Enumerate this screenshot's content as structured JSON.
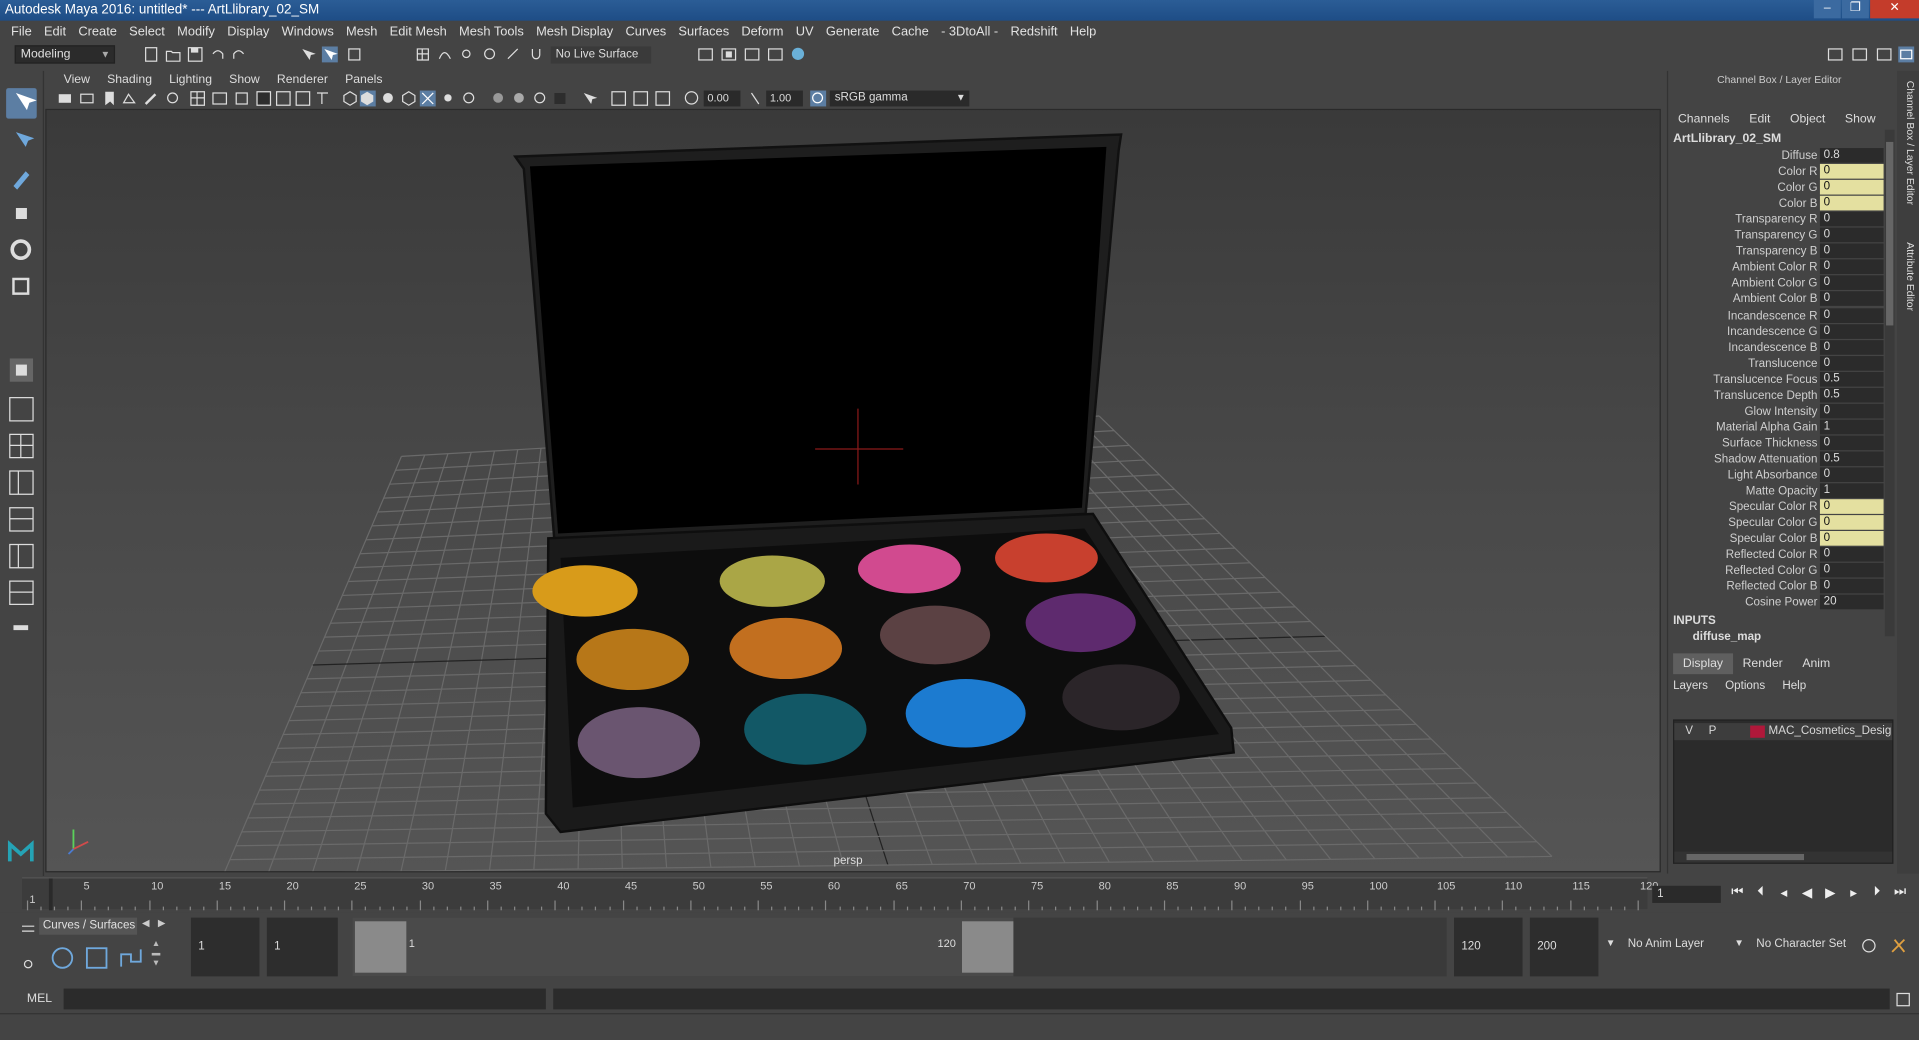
{
  "window": {
    "title": "Autodesk Maya 2016: untitled*   ---   ArtLlibrary_02_SM",
    "minimize": "–",
    "maximize": "❐",
    "close": "✕"
  },
  "menubar": [
    "File",
    "Edit",
    "Create",
    "Select",
    "Modify",
    "Display",
    "Windows",
    "Mesh",
    "Edit Mesh",
    "Mesh Tools",
    "Mesh Display",
    "Curves",
    "Surfaces",
    "Deform",
    "UV",
    "Generate",
    "Cache",
    "- 3DtoAll -",
    "Redshift",
    "Help"
  ],
  "status_line": {
    "mode": "Modeling",
    "live_surface": "No Live Surface"
  },
  "viewport": {
    "menu": [
      "View",
      "Shading",
      "Lighting",
      "Show",
      "Renderer",
      "Panels"
    ],
    "exposure": "0.00",
    "gamma": "1.00",
    "colorspace": "sRGB gamma",
    "camera_label": "persp"
  },
  "channel_box": {
    "header": "Channel Box / Layer Editor",
    "menu": [
      "Channels",
      "Edit",
      "Object",
      "Show"
    ],
    "object_name": "ArtLlibrary_02_SM",
    "attributes": [
      {
        "label": "Diffuse",
        "value": "0.8",
        "keyed": false
      },
      {
        "label": "Color R",
        "value": "0",
        "keyed": true
      },
      {
        "label": "Color G",
        "value": "0",
        "keyed": true
      },
      {
        "label": "Color B",
        "value": "0",
        "keyed": true
      },
      {
        "label": "Transparency R",
        "value": "0",
        "keyed": false
      },
      {
        "label": "Transparency G",
        "value": "0",
        "keyed": false
      },
      {
        "label": "Transparency B",
        "value": "0",
        "keyed": false
      },
      {
        "label": "Ambient Color R",
        "value": "0",
        "keyed": false
      },
      {
        "label": "Ambient Color G",
        "value": "0",
        "keyed": false
      },
      {
        "label": "Ambient Color B",
        "value": "0",
        "keyed": false
      },
      {
        "label": "Incandescence R",
        "value": "0",
        "keyed": false
      },
      {
        "label": "Incandescence G",
        "value": "0",
        "keyed": false
      },
      {
        "label": "Incandescence B",
        "value": "0",
        "keyed": false
      },
      {
        "label": "Translucence",
        "value": "0",
        "keyed": false
      },
      {
        "label": "Translucence Focus",
        "value": "0.5",
        "keyed": false
      },
      {
        "label": "Translucence Depth",
        "value": "0.5",
        "keyed": false
      },
      {
        "label": "Glow Intensity",
        "value": "0",
        "keyed": false
      },
      {
        "label": "Material Alpha Gain",
        "value": "1",
        "keyed": false
      },
      {
        "label": "Surface Thickness",
        "value": "0",
        "keyed": false
      },
      {
        "label": "Shadow Attenuation",
        "value": "0.5",
        "keyed": false
      },
      {
        "label": "Light Absorbance",
        "value": "0",
        "keyed": false
      },
      {
        "label": "Matte Opacity",
        "value": "1",
        "keyed": false
      },
      {
        "label": "Specular Color R",
        "value": "0",
        "keyed": true
      },
      {
        "label": "Specular Color G",
        "value": "0",
        "keyed": true
      },
      {
        "label": "Specular Color B",
        "value": "0",
        "keyed": true
      },
      {
        "label": "Reflected Color R",
        "value": "0",
        "keyed": false
      },
      {
        "label": "Reflected Color G",
        "value": "0",
        "keyed": false
      },
      {
        "label": "Reflected Color B",
        "value": "0",
        "keyed": false
      },
      {
        "label": "Cosine Power",
        "value": "20",
        "keyed": false
      }
    ],
    "inputs_header": "INPUTS",
    "inputs_value": "diffuse_map"
  },
  "layer_editor": {
    "tabs": [
      "Display",
      "Render",
      "Anim"
    ],
    "active_tab": "Display",
    "menu": [
      "Layers",
      "Options",
      "Help"
    ],
    "layer": {
      "v": "V",
      "p": "P",
      "name": "MAC_Cosmetics_Designer",
      "color": "#b0183a"
    }
  },
  "side_tabs": [
    "Channel Box / Layer Editor",
    "Attribute Editor"
  ],
  "time_slider": {
    "ticks": [
      "1",
      "5",
      "10",
      "15",
      "20",
      "25",
      "30",
      "35",
      "40",
      "45",
      "50",
      "55",
      "60",
      "65",
      "70",
      "75",
      "80",
      "85",
      "90",
      "95",
      "100",
      "105",
      "110",
      "115",
      "120"
    ],
    "current_frame": "1"
  },
  "range": {
    "shelf_tab": "Curves / Surfaces",
    "start": "1",
    "playback_start": "1",
    "range_start_label": "1",
    "range_end_label": "120",
    "playback_end": "120",
    "end": "200",
    "anim_layer": "No Anim Layer",
    "character_set": "No Character Set"
  },
  "command_line": {
    "label": "MEL"
  },
  "palette": {
    "pans": [
      {
        "name": "gold",
        "color": "#d89b1a"
      },
      {
        "name": "olive",
        "color": "#aaa646"
      },
      {
        "name": "pink",
        "color": "#d14a8f"
      },
      {
        "name": "red",
        "color": "#c8402e"
      },
      {
        "name": "ochre",
        "color": "#b77718"
      },
      {
        "name": "orange",
        "color": "#c26f1f"
      },
      {
        "name": "brown",
        "color": "#5b4143"
      },
      {
        "name": "purple",
        "color": "#5e2a6e"
      },
      {
        "name": "mauve",
        "color": "#6a5570"
      },
      {
        "name": "teal",
        "color": "#125866"
      },
      {
        "name": "blue",
        "color": "#1c7bd0"
      },
      {
        "name": "charcoal",
        "color": "#2b2529"
      }
    ]
  }
}
